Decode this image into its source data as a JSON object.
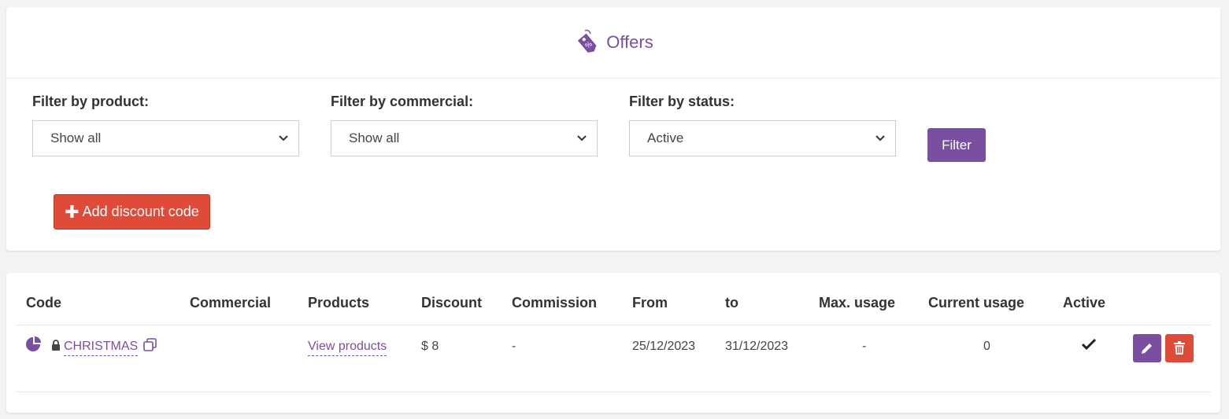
{
  "header": {
    "title": "Offers",
    "icon": "price-tag-percent-icon"
  },
  "filters": [
    {
      "label": "Filter by product:",
      "value": "Show all"
    },
    {
      "label": "Filter by commercial:",
      "value": "Show all"
    },
    {
      "label": "Filter by status:",
      "value": "Active"
    }
  ],
  "buttons": {
    "filter": "Filter",
    "add_discount": "Add discount code"
  },
  "table": {
    "columns": [
      "Code",
      "Commercial",
      "Products",
      "Discount",
      "Commission",
      "From",
      "to",
      "Max. usage",
      "Current usage",
      "Active"
    ],
    "rows": [
      {
        "code": "CHRISTMAS",
        "commercial": "",
        "products": "View products",
        "discount": "$ 8",
        "commission": "-",
        "from": "25/12/2023",
        "to": "31/12/2023",
        "max_usage": "-",
        "current_usage": "0",
        "active": true
      }
    ]
  },
  "colors": {
    "accent": "#7b4fa0",
    "danger": "#e04a38"
  }
}
